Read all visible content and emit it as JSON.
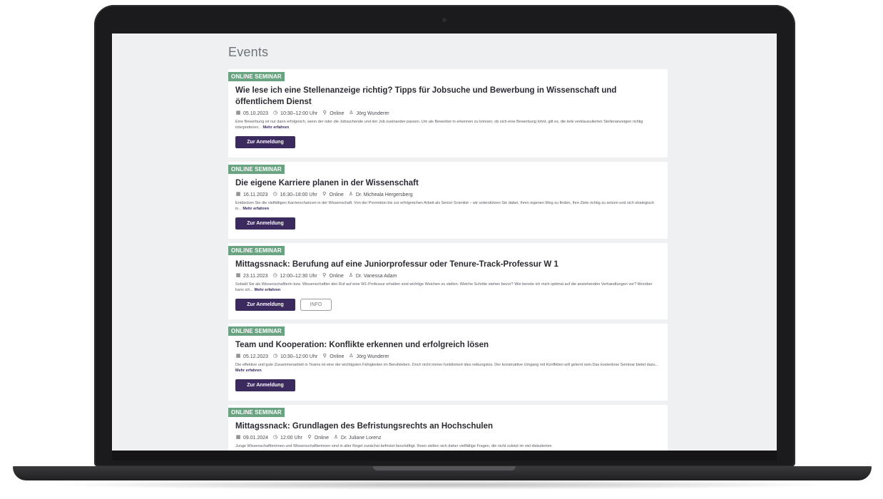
{
  "page": {
    "title": "Events"
  },
  "icons": {
    "date": "calendar-icon",
    "time": "clock-icon",
    "location": "map-pin-icon",
    "speaker": "person-icon"
  },
  "colors": {
    "badge": "#6aa382",
    "button": "#3b2a5e"
  },
  "events": [
    {
      "badge": "ONLINE SEMINAR",
      "title": "Wie lese ich eine Stellenanzeige richtig? Tipps für Jobsuche und Bewerbung in Wissenschaft und öffentlichem Dienst",
      "date": "05.10.2023",
      "time": "10:30–12:00 Uhr",
      "location": "Online",
      "speaker": "Jörg Wunderer",
      "description": "Eine Bewerbung ist nur dann erfolgreich, wenn der oder die Jobsuchende und der Job zueinander passen. Um als Bewerber:in erkennen zu können, ob sich eine Bewerbung lohnt, gilt es, die teils verklausulierten Stellenanzeigen richtig interpretieren...",
      "more": "Mehr erfahren",
      "register": "Zur Anmeldung"
    },
    {
      "badge": "ONLINE SEMINAR",
      "title": "Die eigene Karriere planen in der Wissenschaft",
      "date": "16.11.2023",
      "time": "16:30–18:00 Uhr",
      "location": "Online",
      "speaker": "Dr. Micheala Hergersberg",
      "description": "Entdecken Sie die vielfältigen Karrierechancen in der Wissenschaft. Von der Promotion bis zur erfolgreichen Arbeit als Senior Scientist – wir unterstützen Sie dabei, Ihren eigenen Weg zu finden, Ihre Ziele richtig zu setzen und sich strategisch in...",
      "more": "Mehr erfahren",
      "register": "Zur Anmeldung"
    },
    {
      "badge": "ONLINE SEMINAR",
      "title": "Mittagssnack: Berufung auf eine Juniorprofessur oder Tenure-Track-Professur W 1",
      "date": "23.11.2023",
      "time": "12:00–12:30 Uhr",
      "location": "Online",
      "speaker": "Dr. Vanessa Adam",
      "description": "Sobald Sie als Wissenschaftlerin bzw. Wissenschaftler den Ruf auf eine W1-Professur erhalten sind wichtige Weichen zu stellen. Welche Schritte stehen bevor? Wie bereite ich mich optimal auf die anstehenden Verhandlungen vor? Worüber kann ich...",
      "more": "Mehr erfahren",
      "register": "Zur Anmeldung",
      "info": "INFO"
    },
    {
      "badge": "ONLINE SEMINAR",
      "title": "Team und Kooperation: Konflikte erkennen und erfolgreich lösen",
      "date": "05.12.2023",
      "time": "10:30–12:00 Uhr",
      "location": "Online",
      "speaker": "Jörg Wunderer",
      "description": "Die effektive und gute Zusammenarbeit in Teams ist eine der wichtigsten Fähigkeiten im Berufsleben. Doch nicht immer funktioniert dies reibungslos. Der konstruktive Umgang mit Konflikten will gelernt sein.Das kostenlose Seminar bietet dazu...",
      "more": "Mehr erfahren",
      "register": "Zur Anmeldung"
    },
    {
      "badge": "ONLINE SEMINAR",
      "title": "Mittagssnack: Grundlagen des Befristungsrechts an Hochschulen",
      "date": "09.01.2024",
      "time": "12:00 Uhr",
      "location": "Online",
      "speaker": "Dr. Juliane Lorenz",
      "description": "Junge Wissenschaftlerinnen und Wissenschaftlerinnen sind in aller Regel zunächst befristet beschäftigt. Ihnen stellen sich daher vielfältige Fragen, die nicht zuletzt im viel diskutierten"
    }
  ]
}
